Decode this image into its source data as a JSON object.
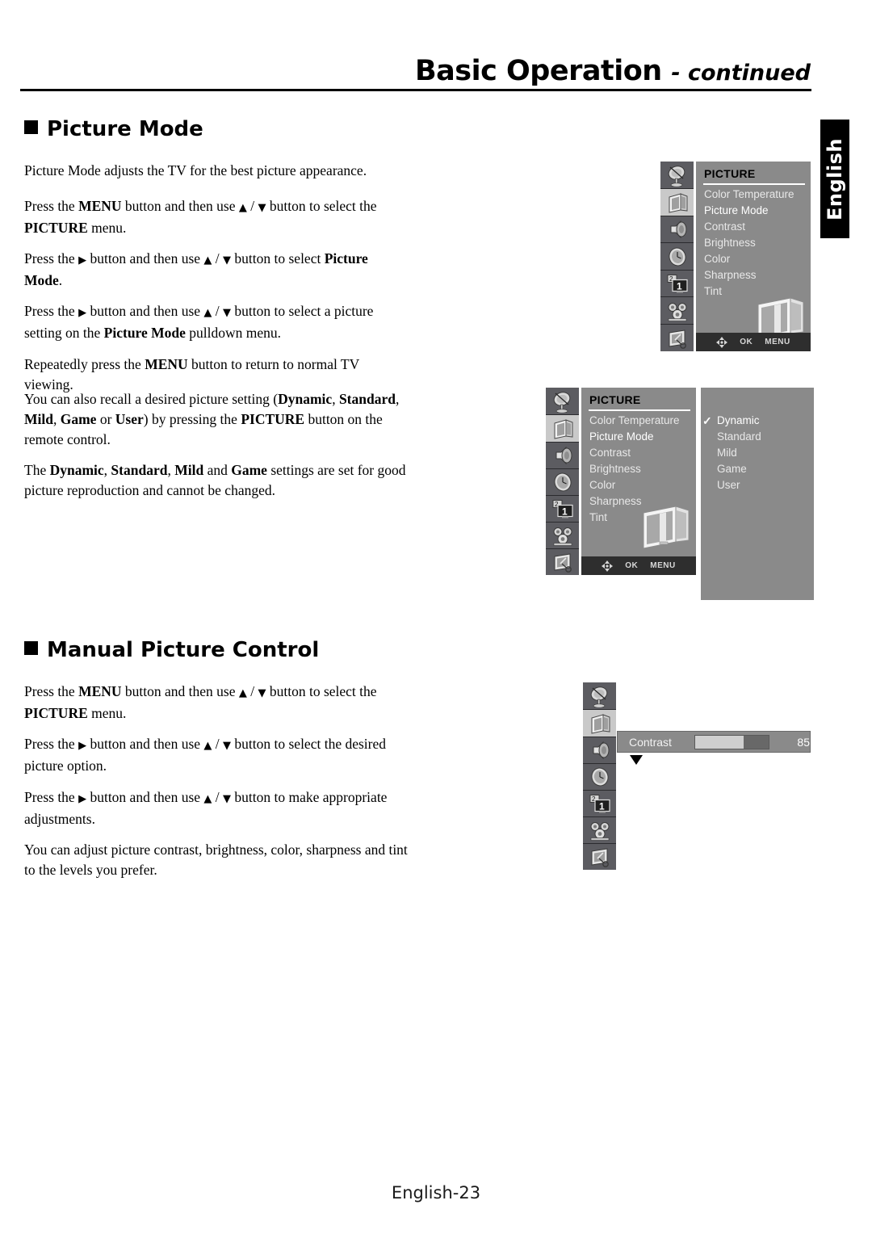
{
  "header": {
    "title_main": "Basic Operation",
    "title_suffix": "- continued",
    "language_tab": "English"
  },
  "sections": [
    {
      "heading": "Picture Mode",
      "paragraphs": [
        "Picture Mode adjusts the TV for the best picture appearance.",
        "Press the MENU button and then use ▲ / ▼ button to select the PICTURE menu.",
        "Press the ▶ button and then use ▲ / ▼ button to select Picture Mode.",
        "Press the ▶ button and then use ▲ / ▼ button to select a picture setting on the Picture Mode pulldown menu.",
        "Repeatedly press the MENU button to return to normal TV viewing.",
        "You can also recall a desired picture setting (Dynamic, Standard, Mild, Game or User) by pressing the PICTURE button on the remote control.",
        "The Dynamic, Standard, Mild and Game settings are set for good picture reproduction and cannot be changed."
      ]
    },
    {
      "heading": "Manual Picture Control",
      "paragraphs": [
        "Press the MENU button and then use ▲ / ▼ button to select the PICTURE menu.",
        "Press the ▶ button and then use ▲ / ▼ button to select the desired picture option.",
        "Press the ▶ button and then use ▲ / ▼ button to make appropriate adjustments.",
        "You can adjust picture contrast, brightness, color, sharpness and tint to the levels you prefer."
      ]
    }
  ],
  "osd": {
    "title": "PICTURE",
    "menu_items": [
      "Color Temperature",
      "Picture Mode",
      "Contrast",
      "Brightness",
      "Color",
      "Sharpness",
      "Tint"
    ],
    "selected_item": "Picture Mode",
    "footer": {
      "nav": "navigation-glyph",
      "ok": "OK",
      "menu": "MENU"
    },
    "rail_icons": [
      "satellite-dish-icon",
      "picture-screen-icon",
      "speaker-icon",
      "clock-icon",
      "pip-2-1-icon",
      "setup-gears-icon",
      "monitor-key-icon"
    ],
    "rail_selected_index": 1,
    "dropdown": {
      "options": [
        "Dynamic",
        "Standard",
        "Mild",
        "Game",
        "User"
      ],
      "checked": "Dynamic"
    },
    "slider": {
      "label": "Contrast",
      "value": "85",
      "fill_percent": 75
    }
  },
  "colors": {
    "osd_panel": "#8a8a8a",
    "osd_rail": "#5c5c61",
    "osd_rail_selected": "#c9c9c9",
    "osd_footer": "#2e2e2e",
    "slider_track": "#cfcfcf",
    "slider_knob": "#686868",
    "tab_background": "#000000"
  },
  "page_footer": "English-23"
}
